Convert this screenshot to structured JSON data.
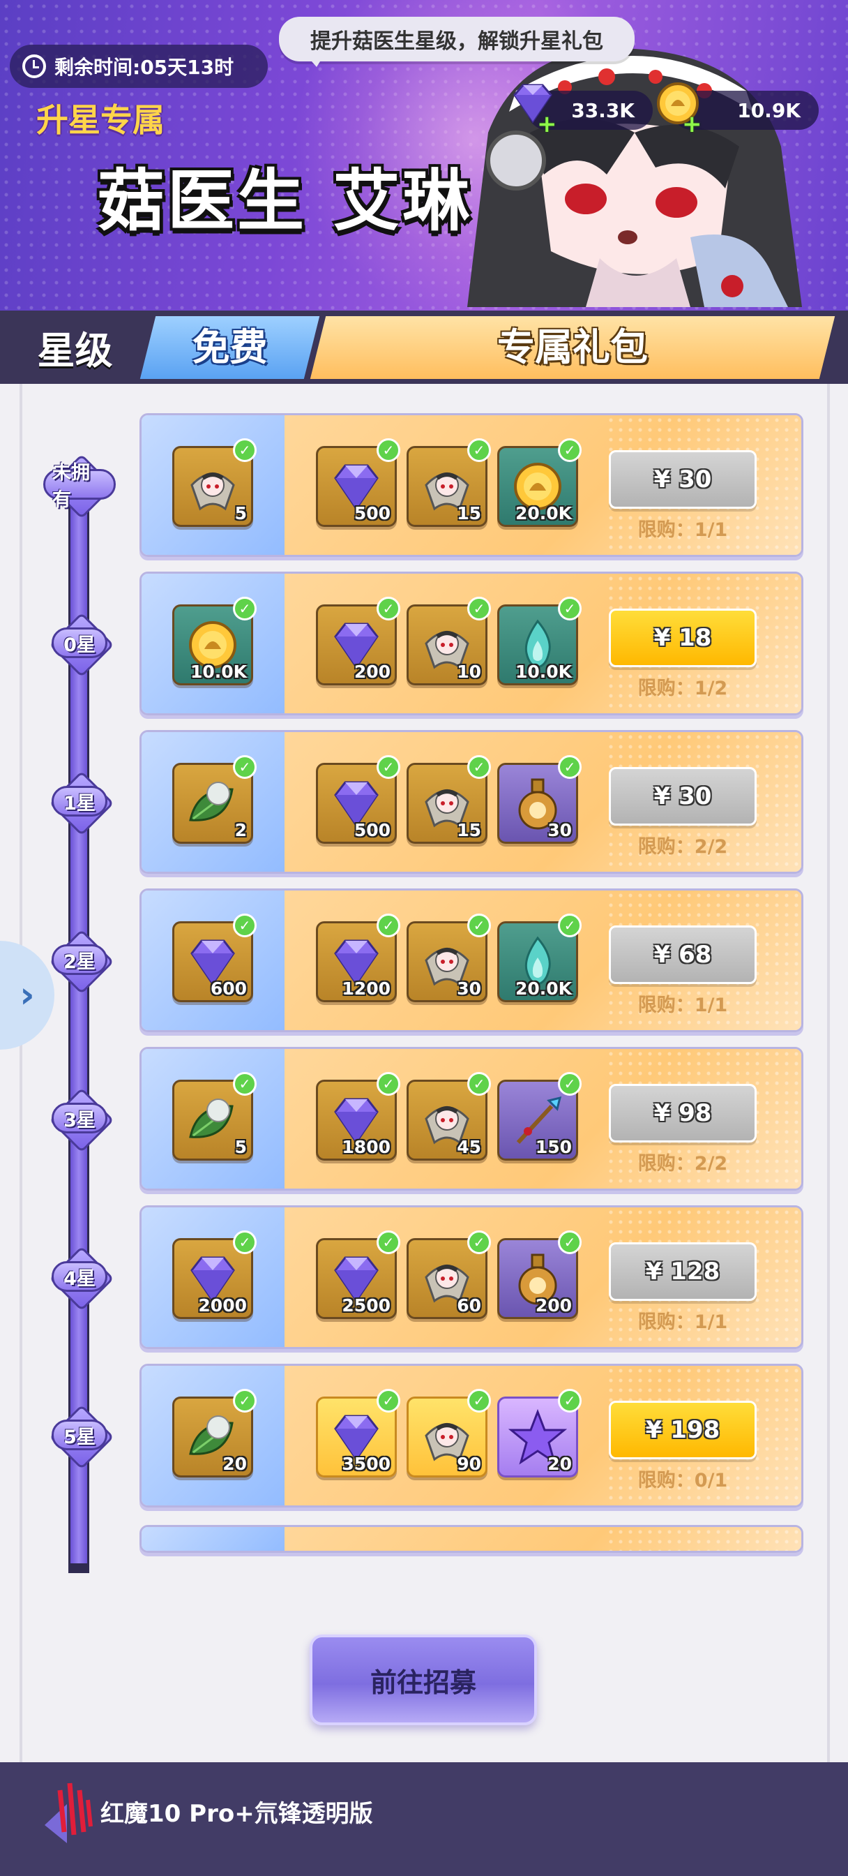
{
  "header": {
    "timer_label": "剩余时间:05天13时",
    "bubble_text": "提升菇医生星级，解锁升星礼包",
    "sub_title": "升星专属",
    "hero_name": "菇医生 艾琳",
    "gems": "33.3K",
    "coins": "10.9K"
  },
  "tabs": {
    "star": "星级",
    "free": "免费",
    "pack": "专属礼包"
  },
  "rows": [
    {
      "level": "未拥有",
      "free_item": {
        "icon": "hero-shard-icon",
        "qty": "5",
        "bg": "gold"
      },
      "pack_items": [
        {
          "icon": "purple-gem-icon",
          "qty": "500",
          "bg": "gold"
        },
        {
          "icon": "hero-shard-icon",
          "qty": "15",
          "bg": "gold"
        },
        {
          "icon": "gold-coin-icon",
          "qty": "20.0K",
          "bg": "teal"
        }
      ],
      "price": "¥ 30",
      "price_style": "gray",
      "limit": "限购：1/1"
    },
    {
      "level": "0星",
      "free_item": {
        "icon": "gold-coin-icon",
        "qty": "10.0K",
        "bg": "teal"
      },
      "pack_items": [
        {
          "icon": "purple-gem-icon",
          "qty": "200",
          "bg": "gold"
        },
        {
          "icon": "hero-shard-icon",
          "qty": "10",
          "bg": "gold"
        },
        {
          "icon": "teal-flame-icon",
          "qty": "10.0K",
          "bg": "teal"
        }
      ],
      "price": "¥ 18",
      "price_style": "yellow",
      "limit": "限购：1/2"
    },
    {
      "level": "1星",
      "free_item": {
        "icon": "leaf-pearl-icon",
        "qty": "2",
        "bg": "gold"
      },
      "pack_items": [
        {
          "icon": "purple-gem-icon",
          "qty": "500",
          "bg": "gold"
        },
        {
          "icon": "hero-shard-icon",
          "qty": "15",
          "bg": "gold"
        },
        {
          "icon": "potion-flask-icon",
          "qty": "30",
          "bg": "purple"
        }
      ],
      "price": "¥ 30",
      "price_style": "gray",
      "limit": "限购：2/2"
    },
    {
      "level": "2星",
      "free_item": {
        "icon": "purple-gem-icon",
        "qty": "600",
        "bg": "gold"
      },
      "pack_items": [
        {
          "icon": "purple-gem-icon",
          "qty": "1200",
          "bg": "gold"
        },
        {
          "icon": "hero-shard-icon",
          "qty": "30",
          "bg": "gold"
        },
        {
          "icon": "teal-flame-icon",
          "qty": "20.0K",
          "bg": "teal"
        }
      ],
      "price": "¥ 68",
      "price_style": "gray",
      "limit": "限购：1/1"
    },
    {
      "level": "3星",
      "free_item": {
        "icon": "leaf-pearl-icon",
        "qty": "5",
        "bg": "gold"
      },
      "pack_items": [
        {
          "icon": "purple-gem-icon",
          "qty": "1800",
          "bg": "gold"
        },
        {
          "icon": "hero-shard-icon",
          "qty": "45",
          "bg": "gold"
        },
        {
          "icon": "spear-icon",
          "qty": "150",
          "bg": "purple"
        }
      ],
      "price": "¥ 98",
      "price_style": "gray",
      "limit": "限购：2/2"
    },
    {
      "level": "4星",
      "free_item": {
        "icon": "purple-gem-icon",
        "qty": "2000",
        "bg": "gold"
      },
      "pack_items": [
        {
          "icon": "purple-gem-icon",
          "qty": "2500",
          "bg": "gold"
        },
        {
          "icon": "hero-shard-icon",
          "qty": "60",
          "bg": "gold"
        },
        {
          "icon": "potion-flask-icon",
          "qty": "200",
          "bg": "purple"
        }
      ],
      "price": "¥ 128",
      "price_style": "gray",
      "limit": "限购：1/1"
    },
    {
      "level": "5星",
      "free_item": {
        "icon": "leaf-pearl-icon",
        "qty": "20",
        "bg": "gold"
      },
      "pack_items": [
        {
          "icon": "purple-gem-icon",
          "qty": "3500",
          "bg": "bright"
        },
        {
          "icon": "hero-shard-icon",
          "qty": "90",
          "bg": "bright"
        },
        {
          "icon": "purple-star-icon",
          "qty": "20",
          "bg": "bright-p"
        }
      ],
      "price": "¥ 198",
      "price_style": "yellow",
      "limit": "限购：0/1"
    }
  ],
  "recruit_button": "前往招募",
  "bottom": {
    "device": "红魔10 Pro+氘锋透明版"
  },
  "colors": {
    "accent_purple": "#7b62e8",
    "price_yellow": "#ffb800",
    "limit_text": "#d39a52",
    "check_green": "#5fd24a"
  }
}
